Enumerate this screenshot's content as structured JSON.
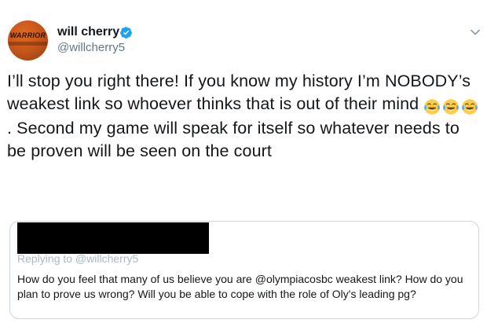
{
  "tweet": {
    "author": {
      "display_name": "will cherry",
      "handle": "@willcherry5",
      "verified": true,
      "avatar_text": "WARRIOR",
      "avatar_color": "#d35f1e"
    },
    "text_before_emoji": "I’ll stop you right there! If you know my history I’m NOBODY’s weakest link so whoever thinks that is out of their mind",
    "emoji": [
      "face-with-tears-of-joy-icon",
      "face-with-tears-of-joy-icon",
      "face-with-tears-of-joy-icon"
    ],
    "text_after_emoji": ". Second my game will speak for itself so whatever needs to be proven will be seen on the court"
  },
  "quoted_tweet": {
    "replying_to": "Replying to @willcherry5",
    "text": "How do you feel that many of us believe you are @olympiacosbc  weakest link? How do you plan to prove us wrong? Will you be able to cope with the role of Oly's leading pg?"
  },
  "colors": {
    "verified_blue": "#1da1f2",
    "secondary_text": "#657786",
    "border": "#ccd6dd"
  }
}
